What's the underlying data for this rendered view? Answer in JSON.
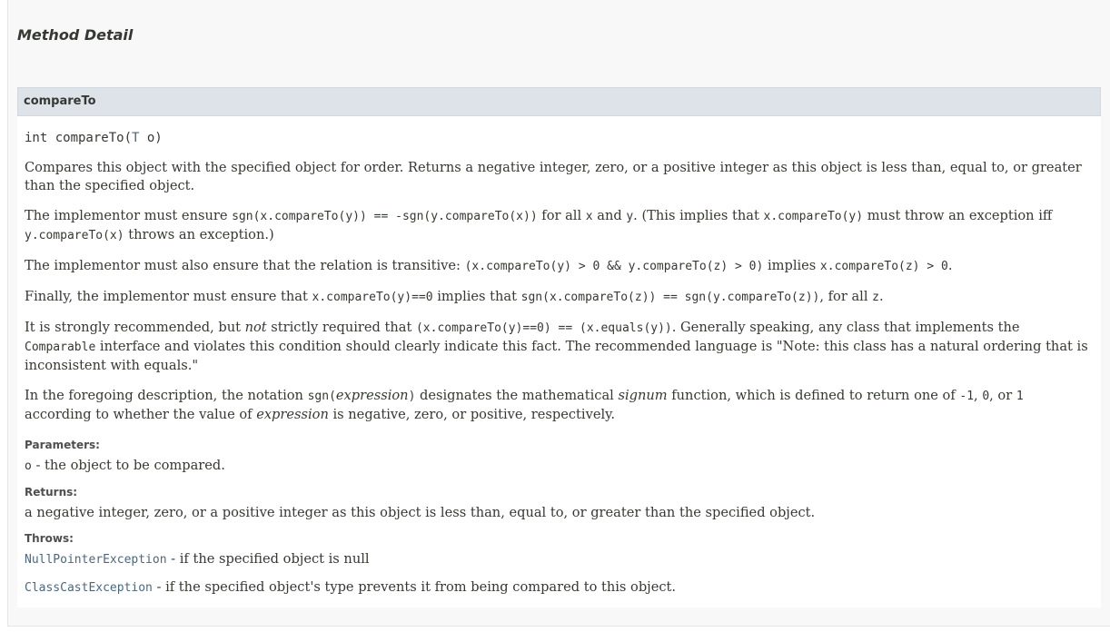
{
  "section": {
    "title": "Method Detail"
  },
  "method": {
    "name": "compareTo",
    "signature": {
      "prefix": "int compareTo(",
      "type_link": "T",
      "suffix": " o)"
    },
    "p1": "Compares this object with the specified object for order. Returns a negative integer, zero, or a positive integer as this object is less than, equal to, or greater than the specified object.",
    "p2": {
      "t1": "The implementor must ensure ",
      "c1": "sgn(x.compareTo(y)) == -sgn(y.compareTo(x))",
      "t2": " for all ",
      "c2": "x",
      "t3": " and ",
      "c3": "y",
      "t4": ". (This implies that ",
      "c4": "x.compareTo(y)",
      "t5": " must throw an exception iff ",
      "c5": "y.compareTo(x)",
      "t6": " throws an exception.)"
    },
    "p3": {
      "t1": "The implementor must also ensure that the relation is transitive: ",
      "c1": "(x.compareTo(y) > 0 && y.compareTo(z) > 0)",
      "t2": " implies ",
      "c2": "x.compareTo(z) > 0",
      "t3": "."
    },
    "p4": {
      "t1": "Finally, the implementor must ensure that ",
      "c1": "x.compareTo(y)==0",
      "t2": " implies that ",
      "c2": "sgn(x.compareTo(z)) == sgn(y.compareTo(z))",
      "t3": ", for all ",
      "c3": "z",
      "t4": "."
    },
    "p5": {
      "t1": "It is strongly recommended, but ",
      "em1": "not",
      "t2": " strictly required that ",
      "c1": "(x.compareTo(y)==0) == (x.equals(y))",
      "t3": ". Generally speaking, any class that implements the ",
      "c2": "Comparable",
      "t4": " interface and violates this condition should clearly indicate this fact. The recommended language is \"Note: this class has a natural ordering that is inconsistent with equals.\""
    },
    "p6": {
      "t1": "In the foregoing description, the notation ",
      "c1a": "sgn(",
      "em1": "expression",
      "c1b": ")",
      "t2": " designates the mathematical ",
      "em2": "signum",
      "t3": " function, which is defined to return one of ",
      "c2": "-1",
      "t4": ", ",
      "c3": "0",
      "t5": ", or ",
      "c4": "1",
      "t6": " according to whether the value of ",
      "em3": "expression",
      "t7": " is negative, zero, or positive, respectively."
    },
    "parameters": {
      "label": "Parameters:",
      "name": "o",
      "desc": " - the object to be compared."
    },
    "returns": {
      "label": "Returns:",
      "desc": "a negative integer, zero, or a positive integer as this object is less than, equal to, or greater than the specified object."
    },
    "throws": {
      "label": "Throws:",
      "items": [
        {
          "name": "NullPointerException",
          "desc": " - if the specified object is null"
        },
        {
          "name": "ClassCastException",
          "desc": " - if the specified object's type prevents it from being compared to this object."
        }
      ]
    }
  }
}
